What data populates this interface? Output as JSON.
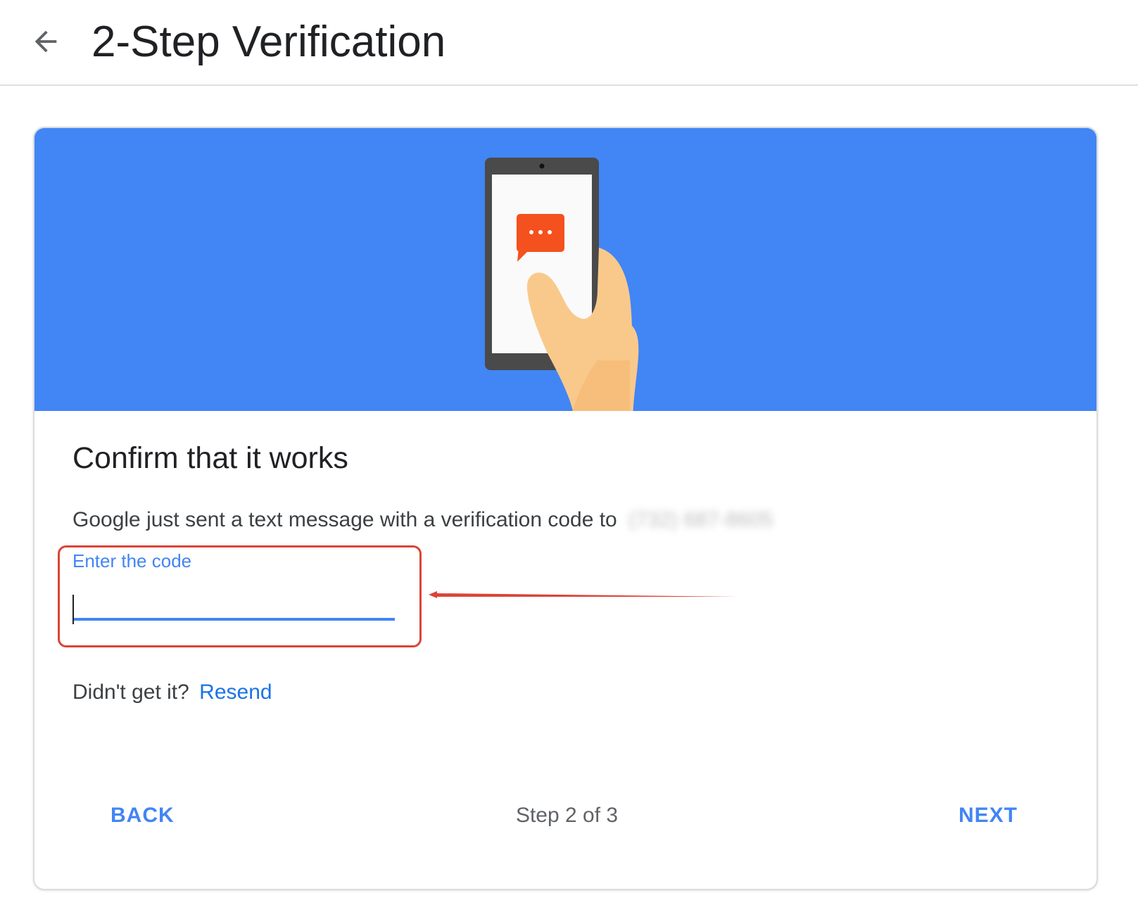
{
  "header": {
    "title": "2-Step Verification",
    "back_icon": "arrow-back-icon"
  },
  "banner": {
    "background_color": "#4285f4",
    "illustration": "phone-in-hand-with-message-icon",
    "message_bubble_color": "#f4511e",
    "message_bubble_text": "···"
  },
  "card": {
    "title": "Confirm that it works",
    "message_prefix": "Google just sent a text message with a verification code to",
    "phone_number_redacted": "(732) 687-8605"
  },
  "code_field": {
    "label": "Enter the code",
    "value": "",
    "accent_color": "#4285f4"
  },
  "annotation": {
    "highlight_color": "#db4437"
  },
  "resend": {
    "prompt": "Didn't get it?",
    "link": "Resend"
  },
  "footer": {
    "back_label": "BACK",
    "step_text": "Step 2 of 3",
    "next_label": "NEXT"
  }
}
